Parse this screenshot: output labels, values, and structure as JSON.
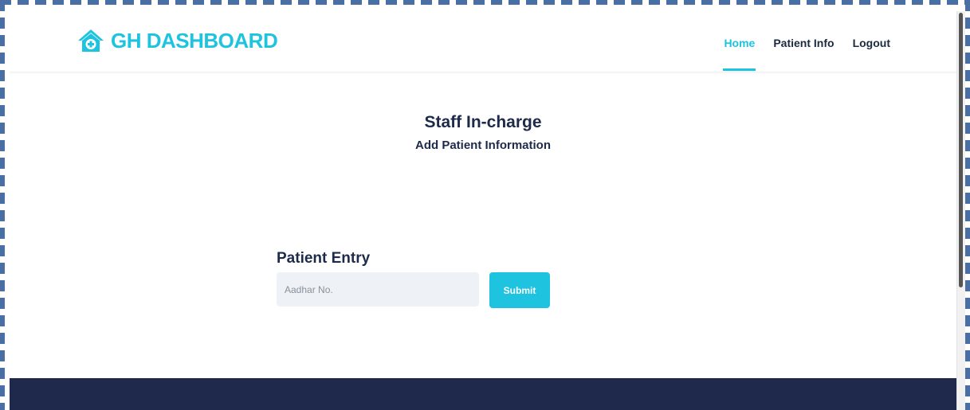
{
  "header": {
    "logo_text": "GH DASHBOARD",
    "nav": [
      {
        "label": "Home",
        "active": true
      },
      {
        "label": "Patient Info",
        "active": false
      },
      {
        "label": "Logout",
        "active": false
      }
    ]
  },
  "main": {
    "title": "Staff In-charge",
    "subtitle": "Add Patient Information",
    "entry": {
      "heading": "Patient Entry",
      "input_placeholder": "Aadhar No.",
      "input_value": "",
      "submit_label": "Submit"
    }
  },
  "icons": {
    "logo": "home-plus-icon"
  },
  "colors": {
    "accent": "#1ec3df",
    "text_dark": "#1e2a4a",
    "footer_bg": "#1f294b",
    "input_bg": "#eef2f6"
  }
}
